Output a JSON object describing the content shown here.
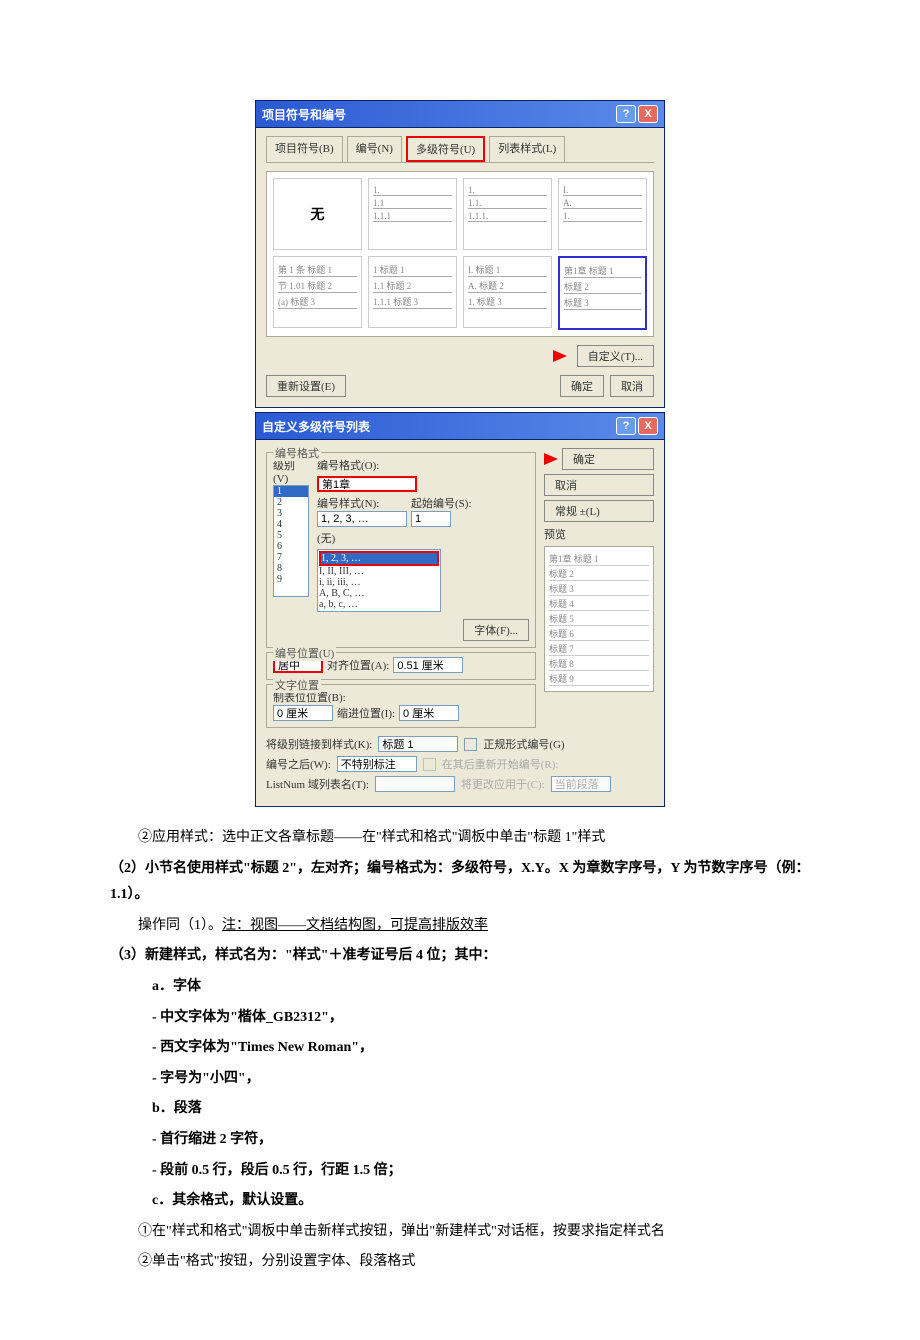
{
  "dialog1": {
    "title": "项目符号和编号",
    "tabs": {
      "t1": "项目符号(B)",
      "t2": "编号(N)",
      "t3": "多级符号(U)",
      "t4": "列表样式(L)"
    },
    "cells": {
      "none": "无",
      "r1c2_1": "1.",
      "r1c2_2": "1.1",
      "r1c2_3": "1.1.1",
      "r1c3_1": "1.",
      "r1c3_2": "1.1.",
      "r1c3_3": "1.1.1.",
      "r1c4_1": "I.",
      "r1c4_2": "A.",
      "r1c4_3": "1.",
      "r2c1_1": "第 1 条 标题 1",
      "r2c1_2": "节 1.01 标题 2",
      "r2c1_3": "(a) 标题 3",
      "r2c2_1": "1 标题 1",
      "r2c2_2": "1.1 标题 2",
      "r2c2_3": "1.1.1 标题 3",
      "r2c3_1": "I. 标题 1",
      "r2c3_2": "A. 标题 2",
      "r2c3_3": "1. 标题 3",
      "r2c4_1": "第1章 标题 1",
      "r2c4_2": "标题 2",
      "r2c4_3": "标题 3"
    },
    "custom_label": "自定义(T)...",
    "reset": "重新设置(E)",
    "ok": "确定",
    "cancel": "取消"
  },
  "dialog2": {
    "title": "自定义多级符号列表",
    "group_format": "编号格式",
    "level_lbl": "级别(V)",
    "format_lbl": "编号格式(O):",
    "format_val": "第1章",
    "style_lbl": "编号样式(N):",
    "style_val": "1, 2, 3, …",
    "start_lbl": "起始编号(S):",
    "start_val": "1",
    "prev_lbl": "(无)",
    "drop_sel": "1, 2, 3, …",
    "drop_o2": "I, II, III, …",
    "drop_o3": "i, ii, iii, …",
    "drop_o4": "A, B, C, …",
    "drop_o5": "a, b, c, …",
    "font_btn": "字体(F)...",
    "group_pos": "编号位置(U)",
    "align_val": "居中",
    "align_pos_lbl": "对齐位置(A):",
    "align_pos_val": "0.51 厘米",
    "group_text": "文字位置",
    "tab_lbl": "制表位位置(B):",
    "tab_val": "0 厘米",
    "indent_lbl": "缩进位置(I):",
    "indent_val": "0 厘米",
    "ok": "确定",
    "cancel": "取消",
    "normal": "常规 ±(L)",
    "preview_lbl": "预览",
    "preview_l1": "第1章 标题 1",
    "preview_l2": "标题 2",
    "preview_l3": "标题 3",
    "preview_l4": "标题 4",
    "preview_l5": "标题 5",
    "preview_l6": "标题 6",
    "preview_l7": "标题 7",
    "preview_l8": "标题 8",
    "preview_l9": "标题 9",
    "link_lbl": "将级别链接到样式(K):",
    "link_val": "标题 1",
    "legal_lbl": "正规形式编号(G)",
    "after_lbl": "编号之后(W):",
    "after_val": "不特别标注",
    "restart_lbl": "在其后重新开始编号(R):",
    "listnum_lbl": "ListNum 域列表名(T):",
    "apply_lbl": "将更改应用于(C):",
    "apply_val": "当前段落"
  },
  "doc": {
    "p1": "②应用样式：选中正文各章标题——在\"样式和格式\"调板中单击\"标题 1\"样式",
    "p2": "（2）小节名使用样式\"标题 2\"，左对齐；编号格式为：多级符号，X.Y。X 为章数字序号，Y 为节数字序号（例：1.1）。",
    "p3_a": "操作同（1）。",
    "p3_b": "注：视图——文档结构图，可提高排版效率",
    "p4": "（3）新建样式，样式名为：\"样式\"＋准考证号后 4 位；其中：",
    "p5": "a．字体",
    "p6": "- 中文字体为\"楷体_GB2312\"，",
    "p7": "- 西文字体为\"Times New Roman\"，",
    "p8": "- 字号为\"小四\"，",
    "p9": "b．段落",
    "p10": "- 首行缩进 2 字符，",
    "p11": "- 段前 0.5 行，段后 0.5 行，行距 1.5 倍；",
    "p12": "c．其余格式，默认设置。",
    "p13": "①在\"样式和格式\"调板中单击新样式按钮，弹出\"新建样式\"对话框，按要求指定样式名",
    "p14": "②单击\"格式\"按钮，分别设置字体、段落格式"
  }
}
